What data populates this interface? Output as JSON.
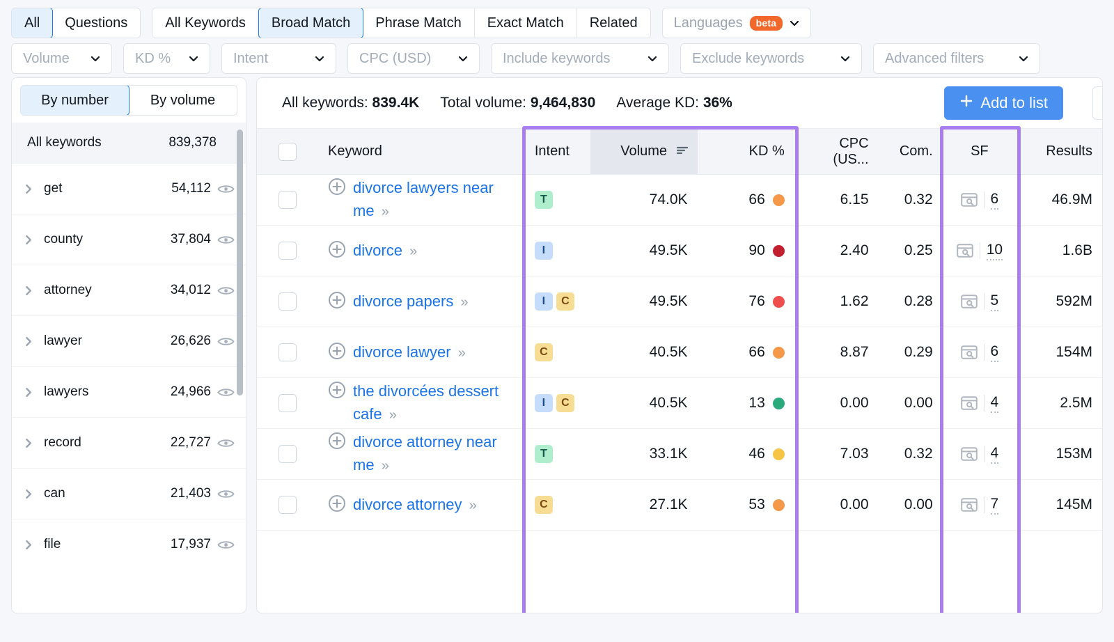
{
  "toolbar": {
    "type_group": [
      {
        "label": "All",
        "active": true
      },
      {
        "label": "Questions",
        "active": false
      }
    ],
    "match_group": [
      {
        "label": "All Keywords",
        "active": false
      },
      {
        "label": "Broad Match",
        "active": true
      },
      {
        "label": "Phrase Match",
        "active": false
      },
      {
        "label": "Exact Match",
        "active": false
      },
      {
        "label": "Related",
        "active": false
      }
    ],
    "languages": {
      "label": "Languages",
      "badge": "beta"
    }
  },
  "filters": [
    {
      "label": "Volume",
      "muted": true
    },
    {
      "label": "KD %",
      "muted": true
    },
    {
      "label": "Intent",
      "muted": false
    },
    {
      "label": "CPC (USD)",
      "muted": true
    },
    {
      "label": "Include keywords",
      "muted": true
    },
    {
      "label": "Exclude keywords",
      "muted": true
    },
    {
      "label": "Advanced filters",
      "muted": true
    }
  ],
  "sidebar": {
    "toggle": [
      {
        "label": "By number",
        "active": true
      },
      {
        "label": "By volume",
        "active": false
      }
    ],
    "all_row": {
      "label": "All keywords",
      "count": "839,378"
    },
    "items": [
      {
        "label": "get",
        "count": "54,112"
      },
      {
        "label": "county",
        "count": "37,804"
      },
      {
        "label": "attorney",
        "count": "34,012"
      },
      {
        "label": "lawyer",
        "count": "26,626"
      },
      {
        "label": "lawyers",
        "count": "24,966"
      },
      {
        "label": "record",
        "count": "22,727"
      },
      {
        "label": "can",
        "count": "21,403"
      },
      {
        "label": "file",
        "count": "17,937"
      }
    ]
  },
  "summary": {
    "all_keywords_label": "All keywords:",
    "all_keywords_value": "839.4K",
    "total_volume_label": "Total volume:",
    "total_volume_value": "9,464,830",
    "average_kd_label": "Average KD:",
    "average_kd_value": "36%",
    "add_to_list": "Add to list",
    "add_icon": "plus-icon"
  },
  "table": {
    "columns": [
      {
        "key": "checkbox",
        "label": ""
      },
      {
        "key": "keyword",
        "label": "Keyword"
      },
      {
        "key": "intent",
        "label": "Intent"
      },
      {
        "key": "volume",
        "label": "Volume",
        "sorted": true,
        "sort_icon": "sort-desc-icon"
      },
      {
        "key": "kd",
        "label": "KD %"
      },
      {
        "key": "cpc",
        "label": "CPC (US..."
      },
      {
        "key": "com",
        "label": "Com."
      },
      {
        "key": "sf",
        "label": "SF"
      },
      {
        "key": "results",
        "label": "Results"
      }
    ],
    "rows": [
      {
        "keyword": "divorce lawyers near me",
        "intent": [
          "T"
        ],
        "volume": "74.0K",
        "kd": "66",
        "kd_color": "#f5984a",
        "cpc": "6.15",
        "com": "0.32",
        "sf": "6",
        "results": "46.9M"
      },
      {
        "keyword": "divorce",
        "intent": [
          "I"
        ],
        "volume": "49.5K",
        "kd": "90",
        "kd_color": "#c21f30",
        "cpc": "2.40",
        "com": "0.25",
        "sf": "10",
        "results": "1.6B"
      },
      {
        "keyword": "divorce papers",
        "intent": [
          "I",
          "C"
        ],
        "volume": "49.5K",
        "kd": "76",
        "kd_color": "#ef4f4c",
        "cpc": "1.62",
        "com": "0.28",
        "sf": "5",
        "results": "592M"
      },
      {
        "keyword": "divorce lawyer",
        "intent": [
          "C"
        ],
        "volume": "40.5K",
        "kd": "66",
        "kd_color": "#f5984a",
        "cpc": "8.87",
        "com": "0.29",
        "sf": "6",
        "results": "154M"
      },
      {
        "keyword": "the divorcées dessert cafe",
        "intent": [
          "I",
          "C"
        ],
        "volume": "40.5K",
        "kd": "13",
        "kd_color": "#2aa97c",
        "cpc": "0.00",
        "com": "0.00",
        "sf": "4",
        "results": "2.5M"
      },
      {
        "keyword": "divorce attorney near me",
        "intent": [
          "T"
        ],
        "volume": "33.1K",
        "kd": "46",
        "kd_color": "#f7c544",
        "cpc": "7.03",
        "com": "0.32",
        "sf": "4",
        "results": "153M"
      },
      {
        "keyword": "divorce attorney",
        "intent": [
          "C"
        ],
        "volume": "27.1K",
        "kd": "53",
        "kd_color": "#f5984a",
        "cpc": "0.00",
        "com": "0.00",
        "sf": "7",
        "results": "145M"
      }
    ]
  },
  "annotations": {
    "highlight_color": "#a97ef0",
    "boxes": [
      {
        "name": "intent-volume-kd-highlight"
      },
      {
        "name": "sf-highlight"
      }
    ]
  }
}
